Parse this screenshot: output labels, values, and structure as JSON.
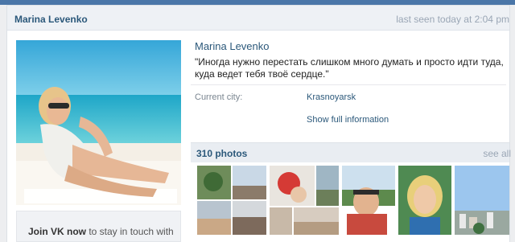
{
  "header": {
    "name": "Marina Levenko",
    "last_seen": "last seen today at 2:04 pm"
  },
  "profile": {
    "name": "Marina Levenko",
    "status": "\"Иногда нужно перестать слишком много думать и просто идти туда, куда ведет тебя твоё сердце.\"",
    "city_label": "Current city:",
    "city_value": "Krasnoyarsk",
    "show_full": "Show full information"
  },
  "join": {
    "bold": "Join VK now",
    "rest": " to stay in touch with"
  },
  "photos": {
    "count_label": "310 photos",
    "see_all": "see all"
  },
  "colors": {
    "link": "#2b587a",
    "header_bg": "#eef1f5",
    "accent": "#4a76a8"
  }
}
